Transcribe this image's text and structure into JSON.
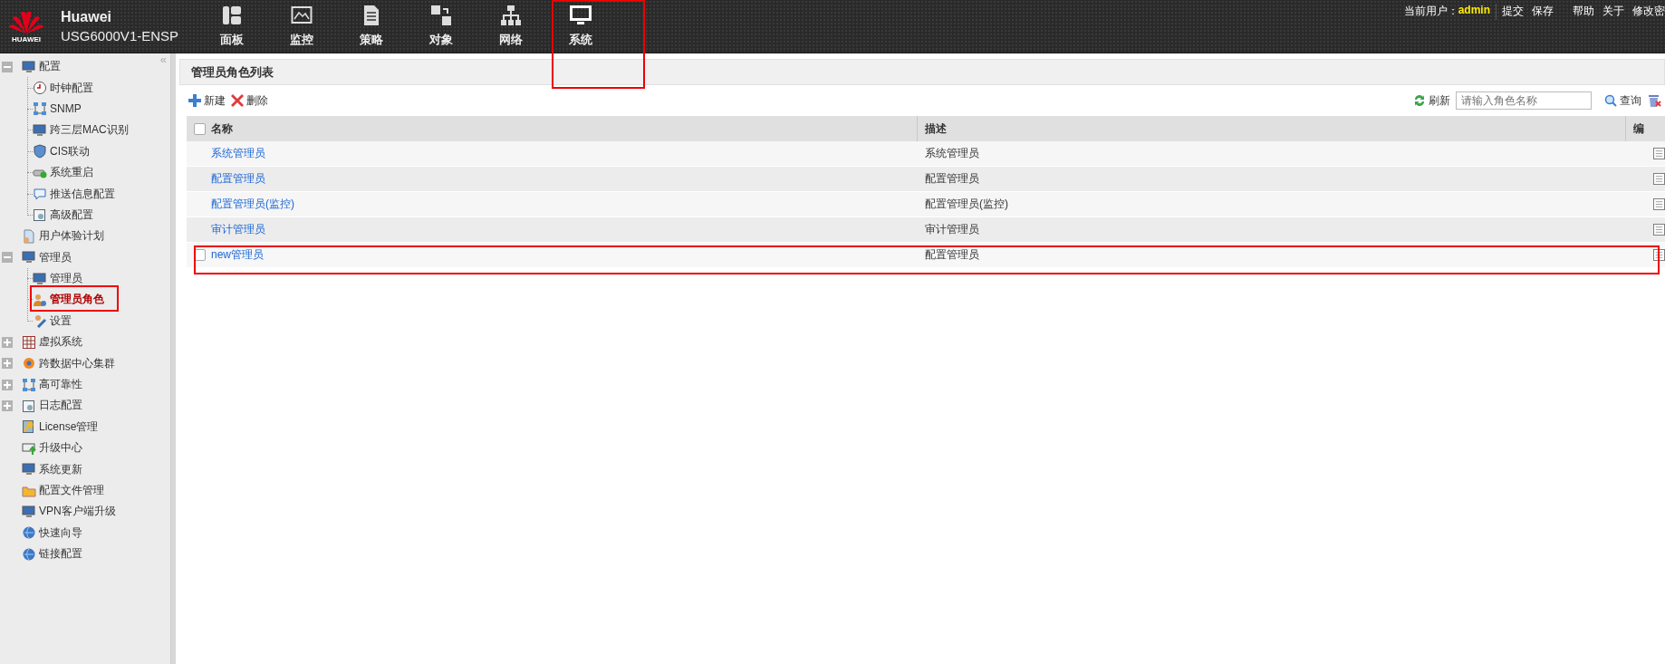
{
  "header": {
    "logo_text": "HUAWEI",
    "brand": "Huawei",
    "model": "USG6000V1-ENSP"
  },
  "nav": [
    {
      "label": "面板"
    },
    {
      "label": "监控"
    },
    {
      "label": "策略"
    },
    {
      "label": "对象"
    },
    {
      "label": "网络"
    },
    {
      "label": "系统"
    }
  ],
  "user_bar": {
    "label": "当前用户：",
    "user": "admin",
    "links": [
      "提交",
      "保存",
      "帮助",
      "关于",
      "修改密"
    ]
  },
  "sidebar": {
    "collapse_glyph": "«",
    "items": [
      {
        "label": "配置",
        "kind": "group",
        "expanded": true,
        "selected": false,
        "children": [
          {
            "label": "时钟配置",
            "selected": false
          },
          {
            "label": "SNMP",
            "selected": false
          },
          {
            "label": "跨三层MAC识别",
            "selected": false
          },
          {
            "label": "CIS联动",
            "selected": false
          },
          {
            "label": "系统重启",
            "selected": false
          },
          {
            "label": "推送信息配置",
            "selected": false
          },
          {
            "label": "高级配置",
            "selected": false
          }
        ]
      },
      {
        "label": "用户体验计划",
        "kind": "leaf",
        "selected": false
      },
      {
        "label": "管理员",
        "kind": "group",
        "expanded": true,
        "selected": false,
        "children": [
          {
            "label": "管理员",
            "selected": false
          },
          {
            "label": "管理员角色",
            "selected": true
          },
          {
            "label": "设置",
            "selected": false
          }
        ]
      },
      {
        "label": "虚拟系统",
        "kind": "group",
        "expanded": false,
        "selected": false
      },
      {
        "label": "跨数据中心集群",
        "kind": "group",
        "expanded": false,
        "selected": false
      },
      {
        "label": "高可靠性",
        "kind": "group",
        "expanded": false,
        "selected": false
      },
      {
        "label": "日志配置",
        "kind": "group",
        "expanded": false,
        "selected": false
      },
      {
        "label": "License管理",
        "kind": "leaf",
        "selected": false
      },
      {
        "label": "升级中心",
        "kind": "leaf",
        "selected": false
      },
      {
        "label": "系统更新",
        "kind": "leaf",
        "selected": false
      },
      {
        "label": "配置文件管理",
        "kind": "leaf",
        "selected": false
      },
      {
        "label": "VPN客户端升级",
        "kind": "leaf",
        "selected": false
      },
      {
        "label": "快速向导",
        "kind": "leaf",
        "selected": false
      },
      {
        "label": "链接配置",
        "kind": "leaf",
        "selected": false
      }
    ]
  },
  "panel": {
    "title": "管理员角色列表",
    "toolbar": {
      "new": "新建",
      "delete": "删除",
      "refresh": "刷新",
      "search_placeholder": "请输入角色名称",
      "query": "查询"
    },
    "table": {
      "columns": [
        "名称",
        "描述",
        "编"
      ],
      "select_all_checked": false,
      "rows": [
        {
          "name": "系统管理员",
          "description": "系统管理员",
          "hovered": false
        },
        {
          "name": "配置管理员",
          "description": "配置管理员",
          "hovered": false
        },
        {
          "name": "配置管理员(监控)",
          "description": "配置管理员(监控)",
          "hovered": false
        },
        {
          "name": "审计管理员",
          "description": "审计管理员",
          "hovered": false
        },
        {
          "name": "new管理员",
          "description": "配置管理员",
          "hovered": true
        }
      ]
    }
  }
}
